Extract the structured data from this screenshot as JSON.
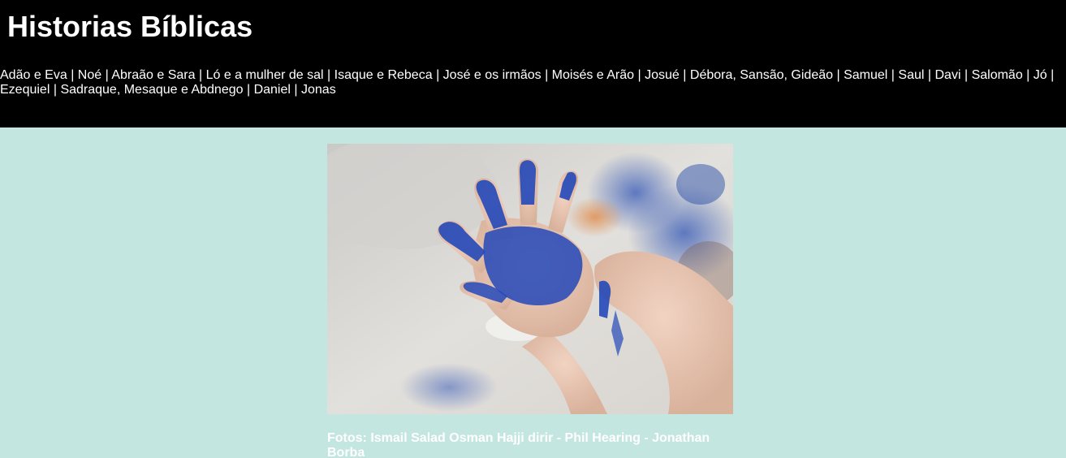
{
  "site": {
    "title": "Historias Bíblicas"
  },
  "nav": {
    "items": [
      "Adão e Eva",
      "Noé",
      "Abraão e Sara",
      "Ló e a mulher de sal",
      "Isaque e Rebeca",
      "José e os irmãos",
      "Moisés e Arão",
      "Josué",
      "Débora, Sansão, Gideão",
      "Samuel",
      "Saul",
      "Davi",
      "Salomão",
      "Jó",
      "Ezequiel",
      "Sadraque, Mesaque e Abdnego",
      "Daniel",
      "Jonas"
    ],
    "separator": "|"
  },
  "main": {
    "photo_icon": "child-painted-hand-photo",
    "caption": "Fotos: Ismail Salad Osman Hajji dirir - Phil Hearing - Jonathan Borba"
  },
  "colors": {
    "header_bg": "#000000",
    "page_bg": "#c3e6e0",
    "text": "#ffffff",
    "paint_blue": "#2448b8"
  }
}
